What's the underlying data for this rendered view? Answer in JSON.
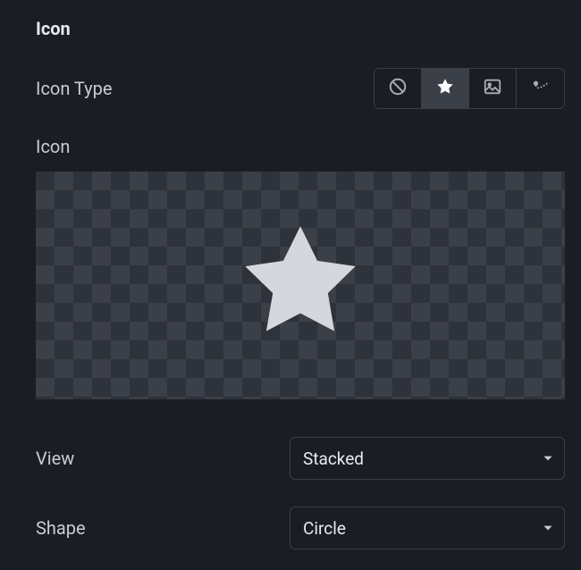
{
  "section": {
    "title": "Icon"
  },
  "iconType": {
    "label": "Icon Type",
    "options": [
      "none",
      "star",
      "image",
      "custom"
    ],
    "selected": "star"
  },
  "preview": {
    "label": "Icon",
    "icon": "star"
  },
  "view": {
    "label": "View",
    "value": "Stacked"
  },
  "shape": {
    "label": "Shape",
    "value": "Circle"
  },
  "colors": {
    "iconFill": "#d4d7dd",
    "segSelectedBg": "#3a3f48"
  }
}
